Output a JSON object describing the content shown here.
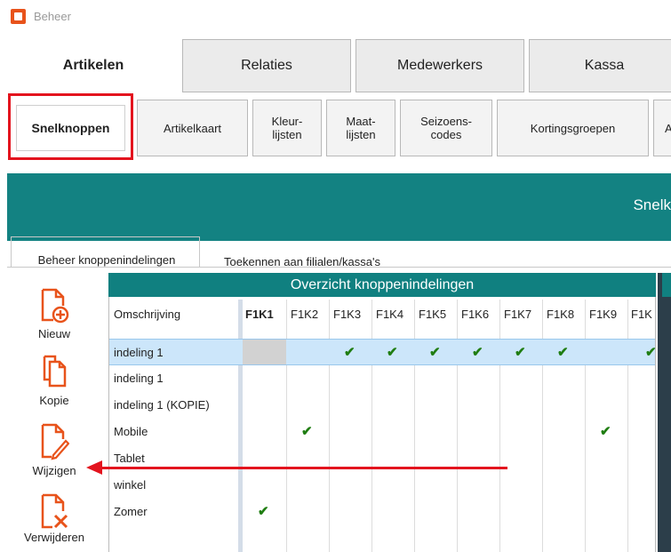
{
  "window": {
    "title": "Beheer"
  },
  "main_tabs": [
    {
      "label": "Artikelen",
      "active": true
    },
    {
      "label": "Relaties",
      "active": false
    },
    {
      "label": "Medewerkers",
      "active": false
    },
    {
      "label": "Kassa",
      "active": false
    }
  ],
  "sub_tabs": [
    {
      "label": "Snelknoppen",
      "active": true
    },
    {
      "label": "Artikelkaart",
      "active": false
    },
    {
      "label": "Kleur-\nlijsten",
      "active": false
    },
    {
      "label": "Maat-\nlijsten",
      "active": false
    },
    {
      "label": "Seizoens-\ncodes",
      "active": false
    },
    {
      "label": "Kortingsgroepen",
      "active": false
    },
    {
      "label": "A",
      "active": false
    }
  ],
  "banner": {
    "title": "Snelk"
  },
  "panel_tabs": [
    {
      "label": "Beheer knoppenindelingen",
      "active": true
    },
    {
      "label": "Toekennen aan filialen/kassa's",
      "active": false
    }
  ],
  "toolbar": {
    "new_label": "Nieuw",
    "copy_label": "Kopie",
    "edit_label": "Wijzigen",
    "delete_label": "Verwijderen"
  },
  "grid": {
    "title": "Overzicht knoppenindelingen",
    "columns": [
      "Omschrijving",
      "F1K1",
      "F1K2",
      "F1K3",
      "F1K4",
      "F1K5",
      "F1K6",
      "F1K7",
      "F1K8",
      "F1K9",
      "F1K"
    ],
    "rows": [
      {
        "label": "indeling 1",
        "selected": true,
        "checks": [
          3,
          4,
          5,
          6,
          7,
          8,
          10
        ]
      },
      {
        "label": "indeling 1",
        "selected": false,
        "checks": []
      },
      {
        "label": "indeling 1 (KOPIE)",
        "selected": false,
        "checks": []
      },
      {
        "label": "Mobile",
        "selected": false,
        "checks": [
          2,
          9
        ]
      },
      {
        "label": "Tablet",
        "selected": false,
        "checks": []
      },
      {
        "label": "winkel",
        "selected": false,
        "checks": []
      },
      {
        "label": "Zomer",
        "selected": false,
        "checks": [
          1
        ]
      }
    ],
    "check_glyph": "✔"
  },
  "colors": {
    "accent_teal": "#108080",
    "highlight_red": "#e3141e",
    "icon_orange": "#e8531b",
    "selected_row": "#cce6fa",
    "check_green": "#1f7d12"
  }
}
